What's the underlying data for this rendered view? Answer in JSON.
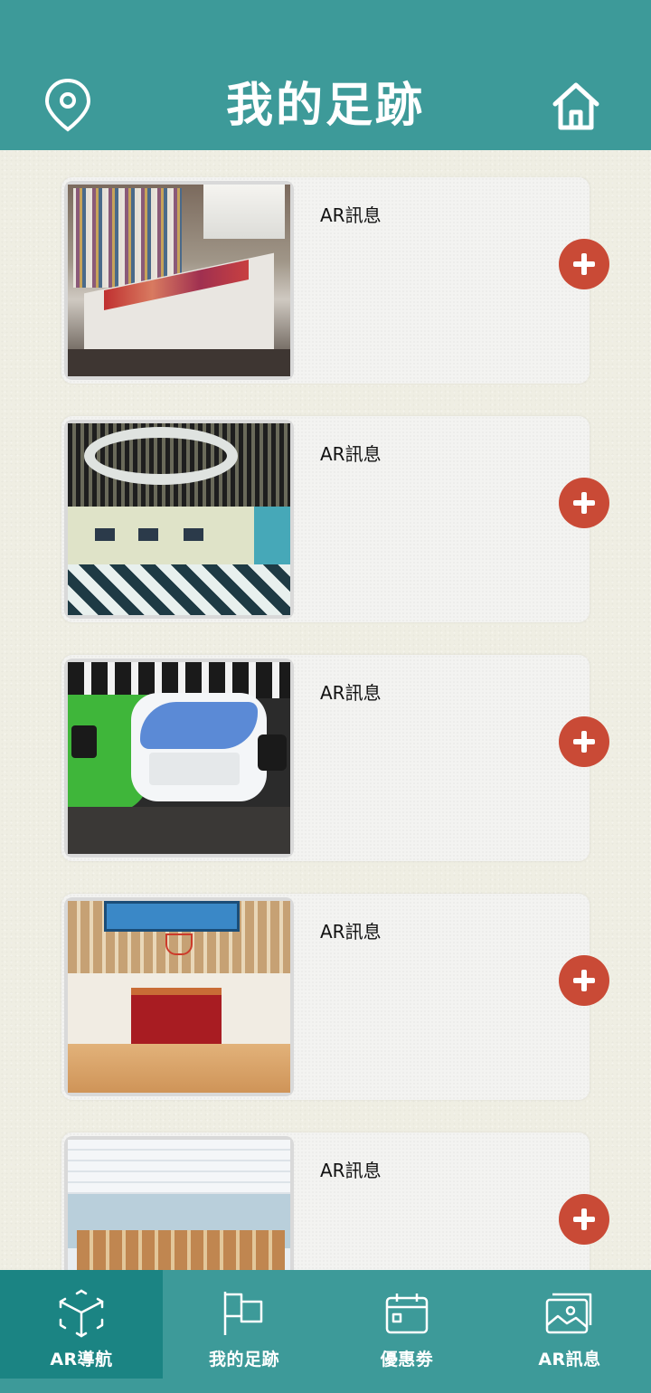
{
  "header": {
    "title": "我的足跡",
    "left_icon": "location-pin-icon",
    "right_icon": "home-icon"
  },
  "items": [
    {
      "label": "AR訊息",
      "photo": "library-exhibition-room"
    },
    {
      "label": "AR訊息",
      "photo": "studio-checkered-floor"
    },
    {
      "label": "AR訊息",
      "photo": "tv-green-screen-studio"
    },
    {
      "label": "AR訊息",
      "photo": "gymnasium-stage"
    },
    {
      "label": "AR訊息",
      "photo": "reading-room"
    }
  ],
  "bottom_nav": [
    {
      "label": "AR導航",
      "icon": "ar-cube-icon",
      "active": true
    },
    {
      "label": "我的足跡",
      "icon": "flag-icon",
      "active": false
    },
    {
      "label": "優惠劵",
      "icon": "calendar-icon",
      "active": false
    },
    {
      "label": "AR訊息",
      "icon": "image-gallery-icon",
      "active": false
    }
  ],
  "colors": {
    "primary": "#3d9a99",
    "active_nav": "#1b8483",
    "add_button": "#c94a36",
    "background": "#efeee3"
  }
}
